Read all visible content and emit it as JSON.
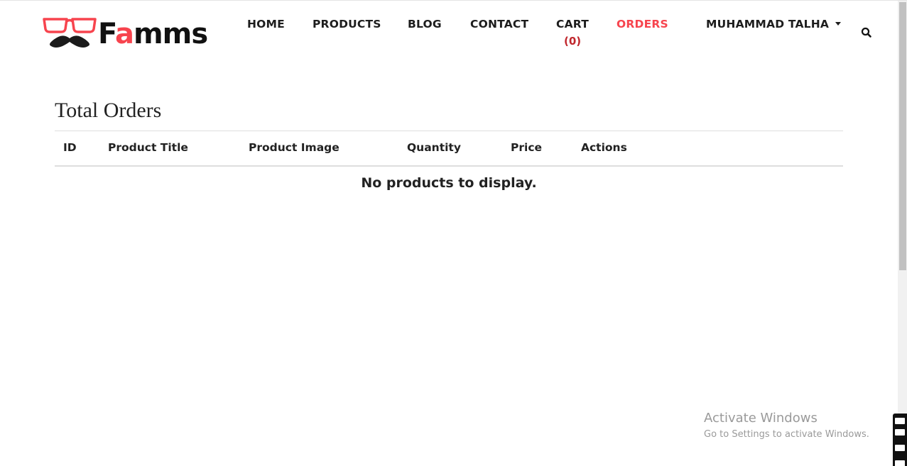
{
  "brand": {
    "prefix": "F",
    "accent": "a",
    "suffix": "mms",
    "accent_color": "#f7444e"
  },
  "nav": {
    "home": "HOME",
    "products": "PRODUCTS",
    "blog": "BLOG",
    "contact": "CONTACT",
    "cart": "CART",
    "cart_count": "(0)",
    "orders": "ORDERS",
    "user": "MUHAMMAD TALHA"
  },
  "icons": {
    "search": "search-icon",
    "user_menu": "caret-down-icon",
    "logo": "glasses-mustache-icon"
  },
  "page": {
    "title": "Total Orders"
  },
  "table": {
    "columns": [
      "ID",
      "Product Title",
      "Product Image",
      "Quantity",
      "Price",
      "Actions"
    ],
    "rows": [],
    "empty_message": "No products to display."
  },
  "watermark": {
    "title": "Activate Windows",
    "subtitle": "Go to Settings to activate Windows."
  }
}
